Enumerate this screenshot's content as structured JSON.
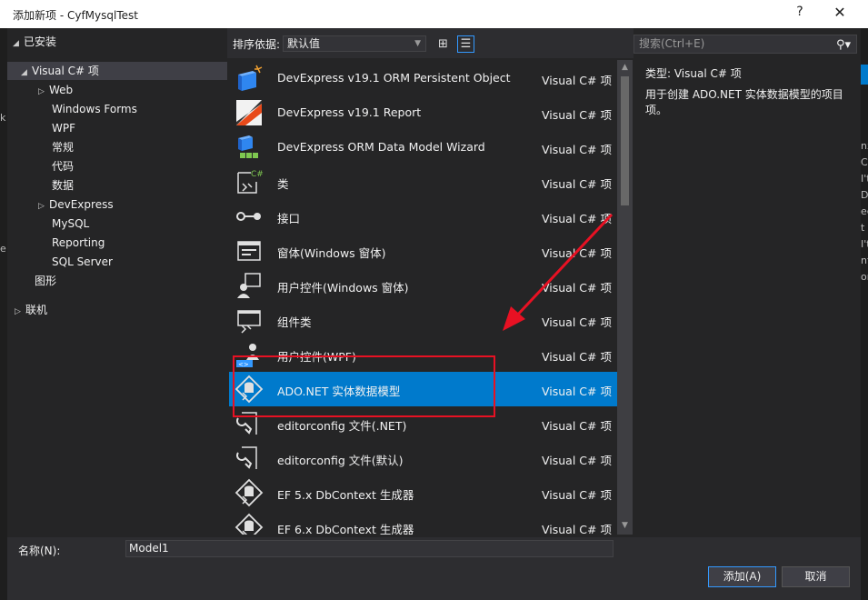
{
  "window": {
    "title": "添加新项 - CyfMysqlTest",
    "help": "?",
    "close": "✕"
  },
  "tree": {
    "installed": "已安装",
    "items": [
      {
        "label": "Visual C# 项",
        "level": 1,
        "arrow": "◢"
      },
      {
        "label": "Web",
        "level": 2,
        "arrow": "▷"
      },
      {
        "label": "Windows Forms",
        "level": 2,
        "arrow": ""
      },
      {
        "label": "WPF",
        "level": 2,
        "arrow": ""
      },
      {
        "label": "常规",
        "level": 2,
        "arrow": ""
      },
      {
        "label": "代码",
        "level": 2,
        "arrow": ""
      },
      {
        "label": "数据",
        "level": 2,
        "arrow": ""
      },
      {
        "label": "DevExpress",
        "level": 2,
        "arrow": "▷"
      },
      {
        "label": "MySQL",
        "level": 2,
        "arrow": ""
      },
      {
        "label": "Reporting",
        "level": 2,
        "arrow": ""
      },
      {
        "label": "SQL Server",
        "level": 2,
        "arrow": ""
      },
      {
        "label": "图形",
        "level": 1,
        "arrow": ""
      }
    ],
    "online": "联机"
  },
  "toolbar": {
    "sort_label": "排序依据:",
    "sort_value": "默认值",
    "grid_icon": "grid-view-icon",
    "list_icon": "list-view-icon"
  },
  "items": [
    {
      "name": "DevExpress v19.1 ORM Persistent Object",
      "type": "Visual C# 项",
      "icon": "devexpress-orm-object-icon"
    },
    {
      "name": "DevExpress v19.1 Report",
      "type": "Visual C# 项",
      "icon": "devexpress-report-icon"
    },
    {
      "name": "DevExpress ORM Data Model Wizard",
      "type": "Visual C# 项",
      "icon": "devexpress-data-model-icon"
    },
    {
      "name": "类",
      "type": "Visual C# 项",
      "icon": "class-icon"
    },
    {
      "name": "接口",
      "type": "Visual C# 项",
      "icon": "interface-icon"
    },
    {
      "name": "窗体(Windows 窗体)",
      "type": "Visual C# 项",
      "icon": "form-icon"
    },
    {
      "name": "用户控件(Windows 窗体)",
      "type": "Visual C# 项",
      "icon": "user-control-icon"
    },
    {
      "name": "组件类",
      "type": "Visual C# 项",
      "icon": "component-icon"
    },
    {
      "name": "用户控件(WPF)",
      "type": "Visual C# 项",
      "icon": "wpf-user-control-icon"
    },
    {
      "name": "ADO.NET 实体数据模型",
      "type": "Visual C# 项",
      "icon": "ado-net-entity-model-icon"
    },
    {
      "name": "editorconfig 文件(.NET)",
      "type": "Visual C# 项",
      "icon": "editorconfig-file-icon"
    },
    {
      "name": "editorconfig 文件(默认)",
      "type": "Visual C# 项",
      "icon": "editorconfig-file-icon"
    },
    {
      "name": "EF 5.x DbContext 生成器",
      "type": "Visual C# 项",
      "icon": "ef-dbcontext-icon"
    },
    {
      "name": "EF 6.x DbContext 生成器",
      "type": "Visual C# 项",
      "icon": "ef-dbcontext-icon"
    }
  ],
  "details": {
    "search_placeholder": "搜索(Ctrl+E)",
    "type_line": "类型:  Visual C# 项",
    "description": "用于创建 ADO.NET 实体数据模型的项目项。"
  },
  "bottom": {
    "name_label": "名称(N):",
    "name_value": "Model1",
    "add_label": "添加(A)",
    "cancel_label": "取消"
  },
  "colors": {
    "selection": "#007acc",
    "highlight_box": "#e81123",
    "arrow": "#e81123"
  }
}
